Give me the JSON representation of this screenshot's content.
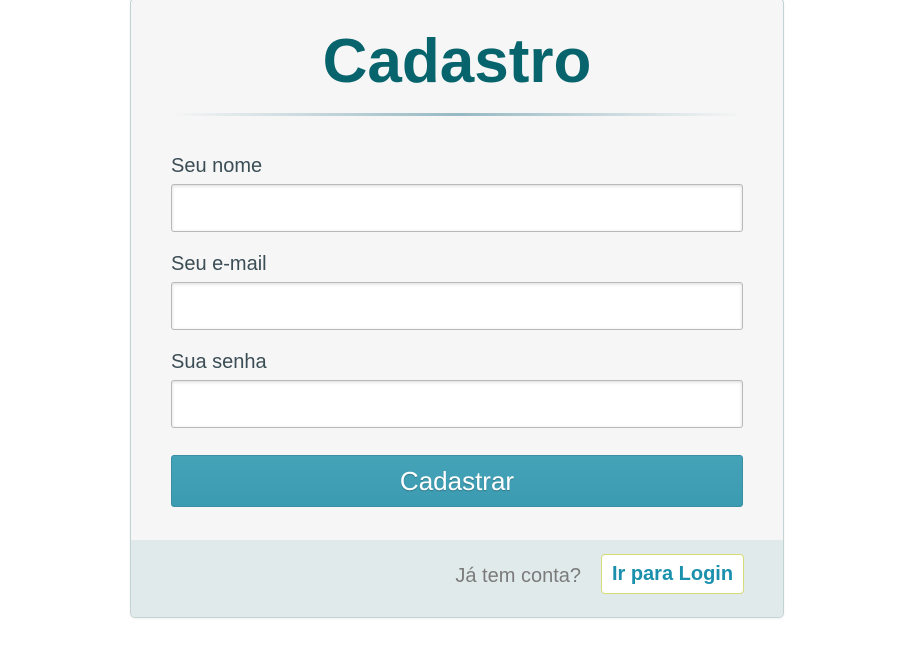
{
  "form": {
    "title": "Cadastro",
    "fields": [
      {
        "label": "Seu nome",
        "value": "",
        "placeholder": ""
      },
      {
        "label": "Seu e-mail",
        "value": "",
        "placeholder": ""
      },
      {
        "label": "Sua senha",
        "value": "",
        "placeholder": ""
      }
    ],
    "submit_label": "Cadastrar"
  },
  "footer": {
    "prompt": "Já tem conta?",
    "login_link": "Ir para Login"
  },
  "colors": {
    "title": "#07646c",
    "button": "#3e9db3",
    "footer_bg": "#e1eaeb",
    "link": "#1a90ad"
  }
}
